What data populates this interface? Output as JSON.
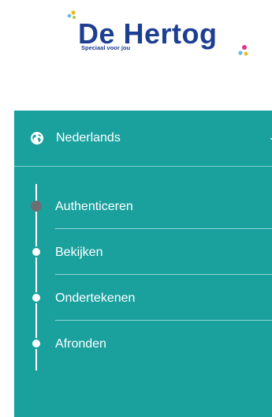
{
  "logo": {
    "name": "De Hertog",
    "tagline": "Speciaal voor jou"
  },
  "language": {
    "label": "Nederlands",
    "icon": "globe-icon",
    "chevron_icon": "chevron-down-icon"
  },
  "steps": [
    {
      "label": "Authenticeren",
      "active": true
    },
    {
      "label": "Bekijken",
      "active": false
    },
    {
      "label": "Ondertekenen",
      "active": false
    },
    {
      "label": "Afronden",
      "active": false
    }
  ],
  "colors": {
    "panel": "#1aa19e",
    "brand_text": "#1d3f92",
    "active_dot": "#6b6f74"
  }
}
